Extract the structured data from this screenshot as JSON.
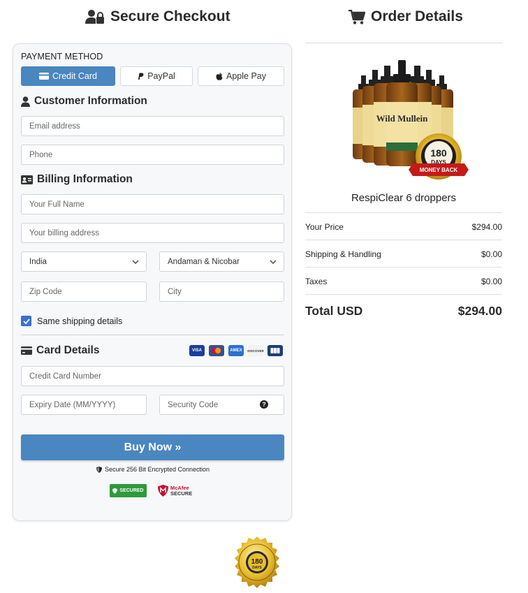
{
  "headers": {
    "checkout_title": "Secure Checkout",
    "order_title": "Order Details"
  },
  "payment": {
    "label": "PAYMENT METHOD",
    "tabs": [
      "Credit Card",
      "PayPal",
      "Apple Pay"
    ],
    "active_tab": "Credit Card"
  },
  "customer": {
    "title": "Customer Information",
    "email_placeholder": "Email address",
    "phone_placeholder": "Phone"
  },
  "billing": {
    "title": "Billing Information",
    "name_placeholder": "Your Full Name",
    "address_placeholder": "Your billing address",
    "country": "India",
    "state": "Andaman & Nicobar",
    "zip_placeholder": "Zip Code",
    "city_placeholder": "City",
    "same_shipping_label": "Same shipping details",
    "same_shipping_checked": true
  },
  "card": {
    "title": "Card Details",
    "number_placeholder": "Credit Card Number",
    "expiry_placeholder": "Expiry Date (MM/YYYY)",
    "cvv_placeholder": "Security Code",
    "brands": [
      "VISA",
      "mastercard",
      "AMEX",
      "DISCOVER",
      "JCB"
    ]
  },
  "buy_button": "Buy Now »",
  "secure_note": "Secure 256 Bit Encrypted Connection",
  "trust_badges": {
    "secured": "SECURED",
    "mcafee_line1": "McAfee",
    "mcafee_line2": "SECURE"
  },
  "order": {
    "product_name": "RespiClear 6 droppers",
    "product_label": "Wild Mullein",
    "seal_days": "180",
    "seal_word": "DAYS",
    "seal_ribbon": "MONEY BACK",
    "rows": [
      {
        "label": "Your Price",
        "value": "$294.00"
      },
      {
        "label": "Shipping & Handling",
        "value": "$0.00"
      },
      {
        "label": "Taxes",
        "value": "$0.00"
      }
    ],
    "total_label": "Total USD",
    "total_value": "$294.00"
  },
  "colors": {
    "accent": "#4a86c0",
    "checkbox": "#3b6fd1",
    "secured_green": "#2e9a3a",
    "mcafee_red": "#c8102e"
  }
}
